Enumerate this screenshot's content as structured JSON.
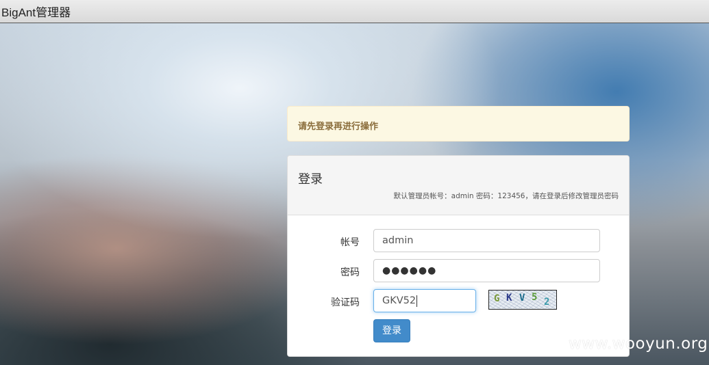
{
  "window": {
    "title": "BigAnt管理器"
  },
  "alert": {
    "message": "请先登录再进行操作"
  },
  "login": {
    "title": "登录",
    "note": "默认管理员帐号：admin 密码：123456，请在登录后修改管理员密码",
    "fields": {
      "account": {
        "label": "帐号",
        "value": "admin"
      },
      "password": {
        "label": "密码",
        "masked": "●●●●●●"
      },
      "captcha": {
        "label": "验证码",
        "value": "GKV52"
      }
    },
    "captcha_image": {
      "chars": [
        "G",
        "K",
        "V",
        "5",
        "2"
      ]
    },
    "submit_label": "登录"
  },
  "watermark": "www.wooyun.org",
  "colors": {
    "primary_button": "#428bca",
    "alert_bg": "#fcf8e3",
    "alert_text": "#8a6d3b",
    "focus_border": "#66afe9"
  }
}
